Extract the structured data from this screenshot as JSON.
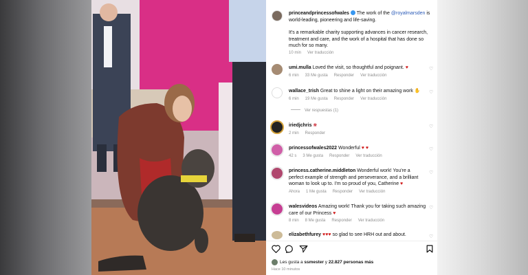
{
  "post": {
    "author": "princeandprincessofwales",
    "caption_pre": " The work of the ",
    "caption_mention": "@royalmarsden",
    "caption_post": " is world-leading, pioneering and life-saving.",
    "caption_p2": "It's a remarkable charity supporting advances in cancer research, treatment and care, and the work of a hospital that has done so much for so many.",
    "time": "10 min",
    "translate": "Ver traducción"
  },
  "comments": [
    {
      "user": "umi.mulla",
      "text": "Loved the visit, so thoughtful and poignant.",
      "time": "6 min",
      "likes": "33 Me gusta",
      "reply": "Responder",
      "translate": "Ver traducción"
    },
    {
      "user": "wallace_trish",
      "text": "Great to shine a light on their amazing work",
      "time": "6 min",
      "likes": "19 Me gusta",
      "reply": "Responder",
      "translate": "Ver traducción",
      "view_replies": "Ver respuestas (1)"
    },
    {
      "user": "iriedjchris",
      "text": "",
      "time": "2 min",
      "reply": "Responder"
    },
    {
      "user": "princessofwales2022",
      "text": "Wonderful",
      "time": "42 s",
      "likes": "3 Me gusta",
      "reply": "Responder",
      "translate": "Ver traducción"
    },
    {
      "user": "princess.catherine.middleton",
      "text": "Wonderful work! You're a perfect example of strength and perseverance, and a brilliant woman to look up to. I'm so proud of you, Catherine",
      "time": "Ahora",
      "likes": "1 Me gusta",
      "reply": "Responder",
      "translate": "Ver traducción"
    },
    {
      "user": "walesvideos",
      "text": "Amazing work! Thank you for taking such amazing care of our Princess",
      "time": "8 min",
      "likes": "8 Me gusta",
      "reply": "Responder",
      "translate": "Ver traducción"
    },
    {
      "user": "elizabethfurey",
      "text": "so glad to see HRH out and about."
    }
  ],
  "footer": {
    "likes_prefix": "Les gusta a ",
    "likes_user": "ssmester",
    "likes_mid": " y ",
    "likes_count": "22.827 personas más",
    "timestamp": "Hace 10 minutos"
  },
  "colors": {
    "accent": "#2b5bb8",
    "heart": "#d01919",
    "verified": "#3897f0"
  },
  "icons": [
    "heart-icon",
    "comment-icon",
    "share-icon",
    "bookmark-icon",
    "verified-badge-icon"
  ]
}
